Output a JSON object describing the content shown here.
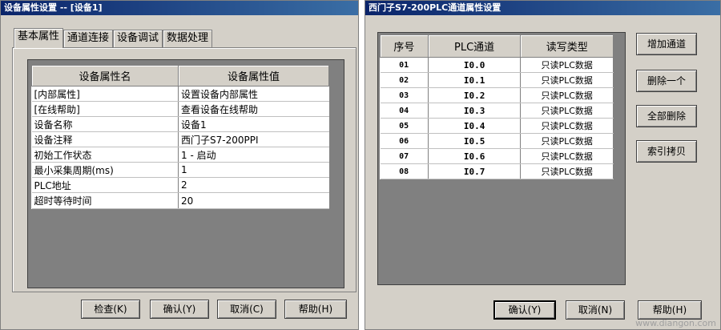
{
  "left_window": {
    "title": "设备属性设置 -- [设备1]",
    "tabs": [
      {
        "label": "基本属性"
      },
      {
        "label": "通道连接"
      },
      {
        "label": "设备调试"
      },
      {
        "label": "数据处理"
      }
    ],
    "table": {
      "headers": [
        "设备属性名",
        "设备属性值"
      ],
      "rows": [
        [
          "[内部属性]",
          "设置设备内部属性"
        ],
        [
          "[在线帮助]",
          "查看设备在线帮助"
        ],
        [
          "设备名称",
          "设备1"
        ],
        [
          "设备注释",
          "西门子S7-200PPI"
        ],
        [
          "初始工作状态",
          "1 - 启动"
        ],
        [
          "最小采集周期(ms)",
          "1"
        ],
        [
          "PLC地址",
          "2"
        ],
        [
          "超时等待时间",
          "20"
        ]
      ]
    },
    "buttons": {
      "check": "检查(K)",
      "ok": "确认(Y)",
      "cancel": "取消(C)",
      "help": "帮助(H)"
    }
  },
  "right_window": {
    "title": "西门子S7-200PLC通道属性设置",
    "table": {
      "headers": [
        "序号",
        "PLC通道",
        "读写类型"
      ],
      "rows": [
        [
          "01",
          "I0.0",
          "只读PLC数据"
        ],
        [
          "02",
          "I0.1",
          "只读PLC数据"
        ],
        [
          "03",
          "I0.2",
          "只读PLC数据"
        ],
        [
          "04",
          "I0.3",
          "只读PLC数据"
        ],
        [
          "05",
          "I0.4",
          "只读PLC数据"
        ],
        [
          "06",
          "I0.5",
          "只读PLC数据"
        ],
        [
          "07",
          "I0.6",
          "只读PLC数据"
        ],
        [
          "08",
          "I0.7",
          "只读PLC数据"
        ]
      ]
    },
    "side_buttons": {
      "add": "增加通道",
      "delete_one": "删除一个",
      "delete_all": "全部删除",
      "index_copy": "索引拷贝"
    },
    "buttons": {
      "ok": "确认(Y)",
      "cancel": "取消(N)",
      "help": "帮助(H)"
    }
  },
  "watermark": "www.diangon.com"
}
